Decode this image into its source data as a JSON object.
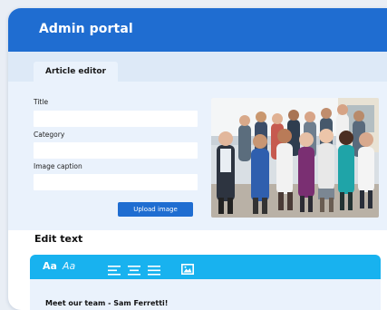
{
  "header": {
    "title": "Admin portal"
  },
  "tabs": [
    {
      "label": "Article editor"
    }
  ],
  "form": {
    "title_label": "Title",
    "category_label": "Category",
    "caption_label": "Image caption",
    "title_value": "",
    "category_value": "",
    "caption_value": "",
    "upload_label": "Upload image"
  },
  "image": {
    "icon": "team-photo"
  },
  "edit_text": {
    "heading": "Edit text",
    "toolbar": {
      "font_bold_label": "Aa",
      "font_italic_label": "Aa",
      "icons": [
        "align-left-icon",
        "align-center-icon",
        "align-justify-icon",
        "insert-image-icon"
      ]
    },
    "content": "Meet our team - Sam Ferretti!"
  },
  "colors": {
    "header": "#1f6dd1",
    "toolbar": "#18b2ef",
    "panel": "#eaf2fc",
    "button": "#1f6dd1"
  }
}
